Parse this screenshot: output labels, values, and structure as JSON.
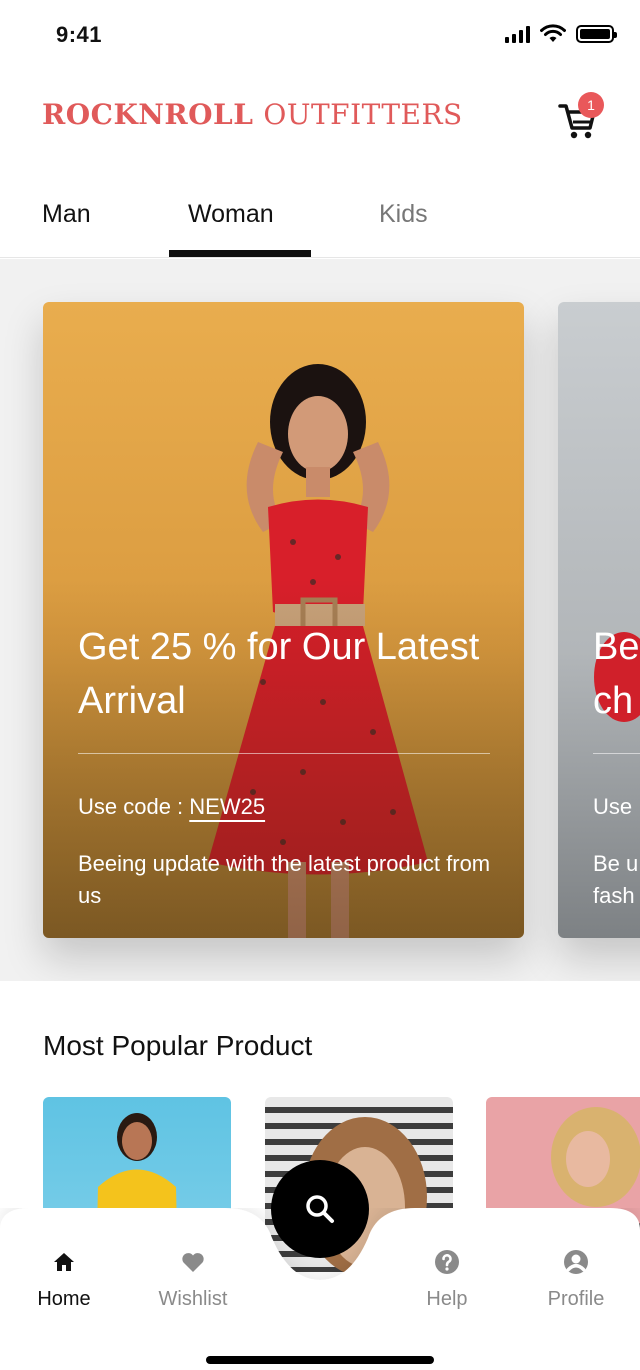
{
  "status_bar": {
    "time": "9:41"
  },
  "header": {
    "brand_part1": "ROCKNROLL",
    "brand_part2": "OUTFITTERS",
    "brand_color": "#e05a5a",
    "cart_icon": "cart-icon",
    "cart_count": "1"
  },
  "tabs": [
    {
      "label": "Man"
    },
    {
      "label": "Woman"
    },
    {
      "label": "Kids"
    }
  ],
  "active_tab": "Woman",
  "banners": [
    {
      "title": "Get 25 % for Our Latest Arrival",
      "code_label": "Use code : ",
      "code": "NEW25",
      "description": "Beeing update with the latest product from us"
    },
    {
      "title": "Be ch",
      "code_label": "Use",
      "description": "Be u fash"
    }
  ],
  "popular": {
    "title": "Most Popular Product"
  },
  "bottom_nav": {
    "items": [
      {
        "label": "Home",
        "icon": "home-icon"
      },
      {
        "label": "Wishlist",
        "icon": "heart-icon"
      },
      {
        "label": "Help",
        "icon": "help-icon"
      },
      {
        "label": "Profile",
        "icon": "profile-icon"
      }
    ],
    "fab_icon": "search-icon",
    "active": "Home"
  }
}
